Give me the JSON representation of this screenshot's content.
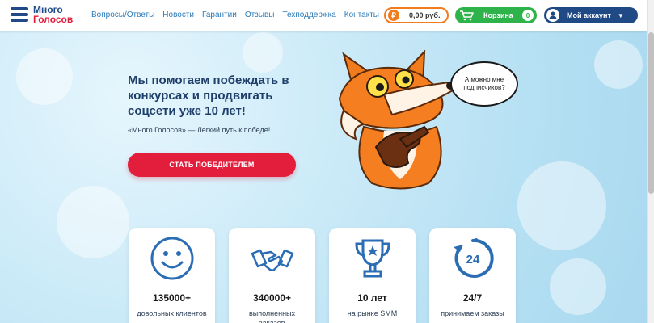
{
  "header": {
    "logo_line1": "Много",
    "logo_line2": "Голосов",
    "nav": [
      "Вопросы/Ответы",
      "Новости",
      "Гарантии",
      "Отзывы",
      "Техподдержка",
      "Контакты"
    ],
    "balance": "0,00 руб.",
    "balance_symbol": "₽",
    "cart_label": "Корзина",
    "cart_count": "0",
    "account_label": "Мой аккаунт"
  },
  "hero": {
    "title": "Мы помогаем побеждать в конкурсах и продвигать соцсети уже 10 лет!",
    "subtitle": "«Много Голосов» — Легкий путь к победе!",
    "cta": "СТАТЬ ПОБЕДИТЕЛЕМ",
    "bubble": "А можно мне подписчиков?"
  },
  "stats": [
    {
      "icon": "smile-icon",
      "number": "135000+",
      "desc": "довольных клиентов"
    },
    {
      "icon": "handshake-icon",
      "number": "340000+",
      "desc": "выполненных заказов"
    },
    {
      "icon": "trophy-icon",
      "number": "10 лет",
      "desc": "на рынке SMM"
    },
    {
      "icon": "clock-24-icon",
      "number": "24/7",
      "desc": "принимаем заказы"
    }
  ],
  "colors": {
    "brand_blue": "#1f4a86",
    "brand_red": "#e21e3c",
    "cart_green": "#2eb24a",
    "balance_orange": "#f07c1e",
    "icon_blue": "#2a6db5"
  }
}
